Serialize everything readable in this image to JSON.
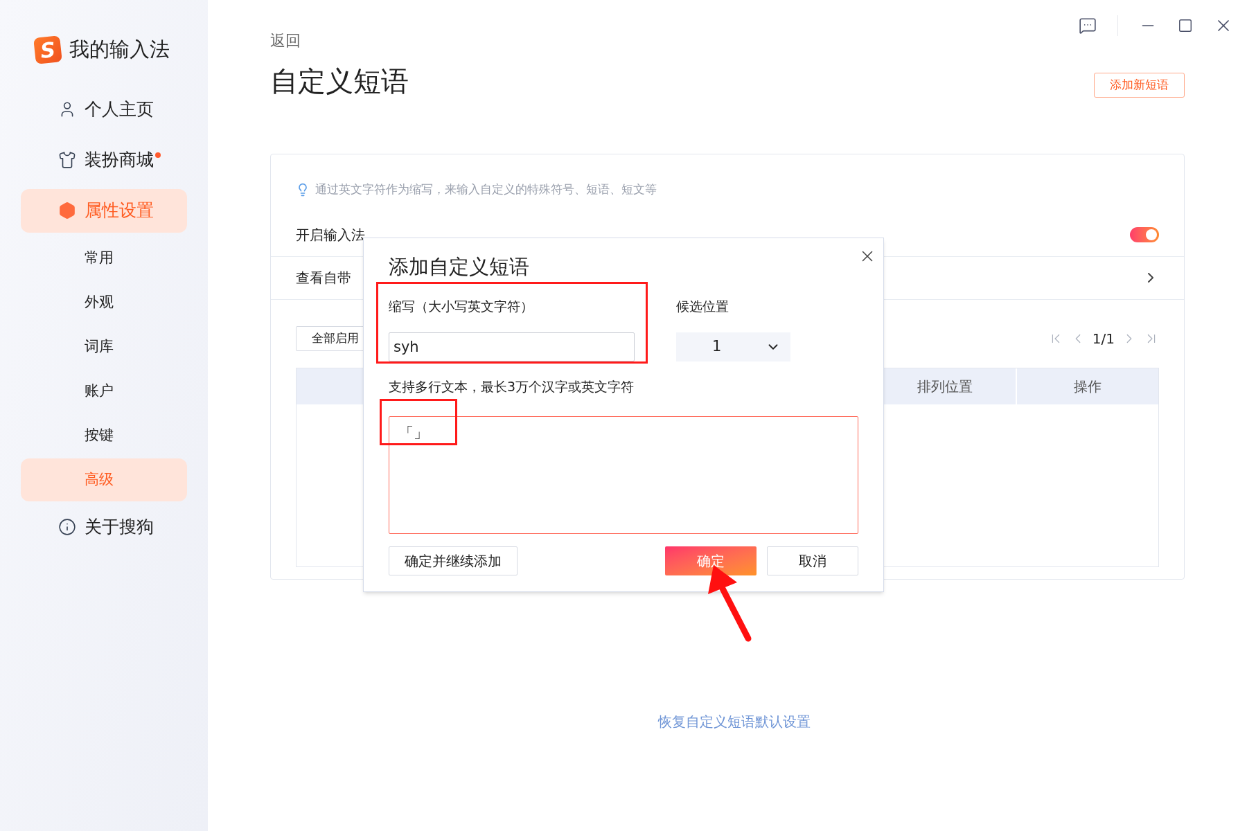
{
  "app": {
    "logo_letter": "S",
    "name": "我的输入法"
  },
  "sidebar": {
    "items": [
      {
        "label": "个人主页",
        "kind": "user",
        "selected": false
      },
      {
        "label": "装扮商城",
        "kind": "shirt",
        "selected": false,
        "dot": true
      },
      {
        "label": "属性设置",
        "kind": "hexagon",
        "selected": true,
        "children": [
          {
            "label": "常用",
            "selected": false
          },
          {
            "label": "外观",
            "selected": false
          },
          {
            "label": "词库",
            "selected": false
          },
          {
            "label": "账户",
            "selected": false
          },
          {
            "label": "按键",
            "selected": false
          },
          {
            "label": "高级",
            "selected": true
          }
        ]
      },
      {
        "label": "关于搜狗",
        "kind": "info",
        "selected": false
      }
    ]
  },
  "page": {
    "back": "返回",
    "title": "自定义短语",
    "add_button": "添加新短语",
    "tip": "通过英文字符作为缩写，来输入自定义的特殊符号、短语、短文等",
    "settings": [
      {
        "kind": "toggle",
        "label": "开启输入法",
        "on": true
      },
      {
        "kind": "link",
        "label": "查看自带"
      }
    ],
    "enable_all": "全部启用",
    "pagination": "1/1",
    "table": {
      "columns": [
        "排列位置",
        "操作"
      ]
    },
    "restore_link": "恢复自定义短语默认设置"
  },
  "dialog": {
    "title": "添加自定义短语",
    "abbr_label": "缩写（大小写英文字符）",
    "abbr_value": "syh",
    "position_label": "候选位置",
    "position_value": "1",
    "content_label": "支持多行文本，最长3万个汉字或英文字符",
    "content_value": "「」",
    "buttons": [
      {
        "kind": "secondary",
        "label": "确定并继续添加"
      },
      {
        "kind": "primary",
        "label": "确定"
      },
      {
        "kind": "secondary",
        "label": "取消"
      }
    ]
  }
}
